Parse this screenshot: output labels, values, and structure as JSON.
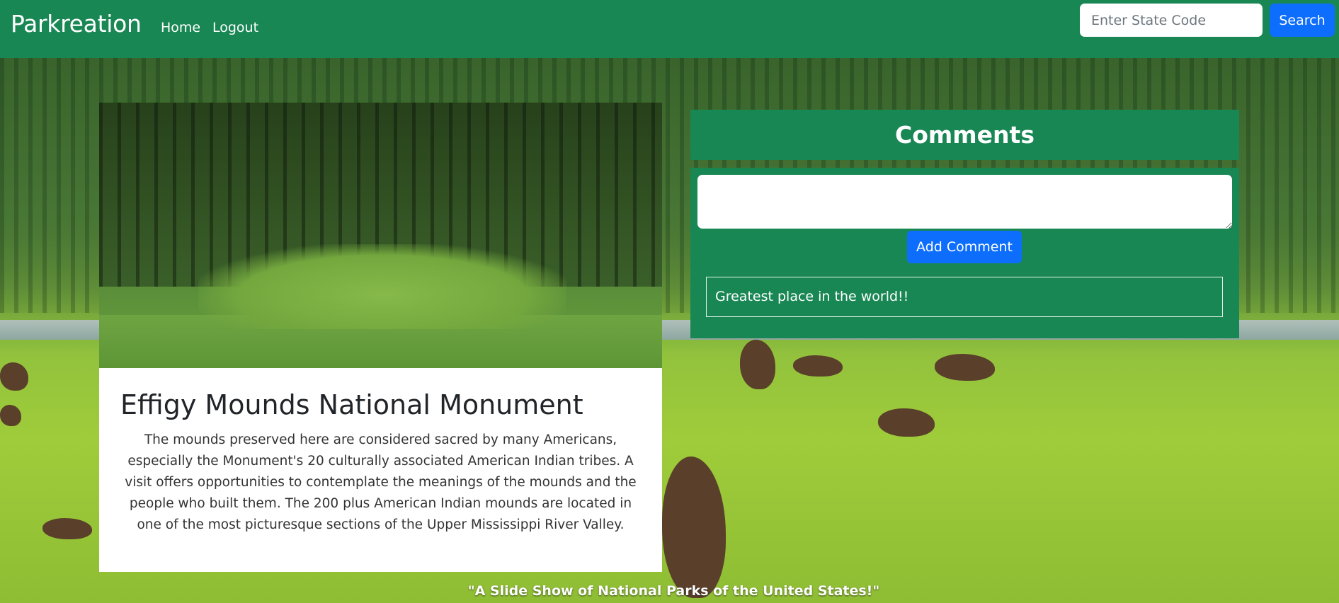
{
  "navbar": {
    "brand": "Parkreation",
    "links": [
      "Home",
      "Logout"
    ],
    "search_placeholder": "Enter State Code",
    "search_button": "Search"
  },
  "park": {
    "title": "Effigy Mounds National Monument",
    "description": "The mounds preserved here are considered sacred by many Americans, especially the Monument's 20 culturally associated American Indian tribes. A visit offers opportunities to contemplate the meanings of the mounds and the people who built them. The 200 plus American Indian mounds are located in one of the most picturesque sections of the Upper Mississippi River Valley."
  },
  "comments": {
    "header": "Comments",
    "add_button": "Add Comment",
    "items": [
      "Greatest place in the world!!"
    ]
  },
  "footer": {
    "tagline": "\"A Slide Show of National Parks of the United States!\""
  }
}
